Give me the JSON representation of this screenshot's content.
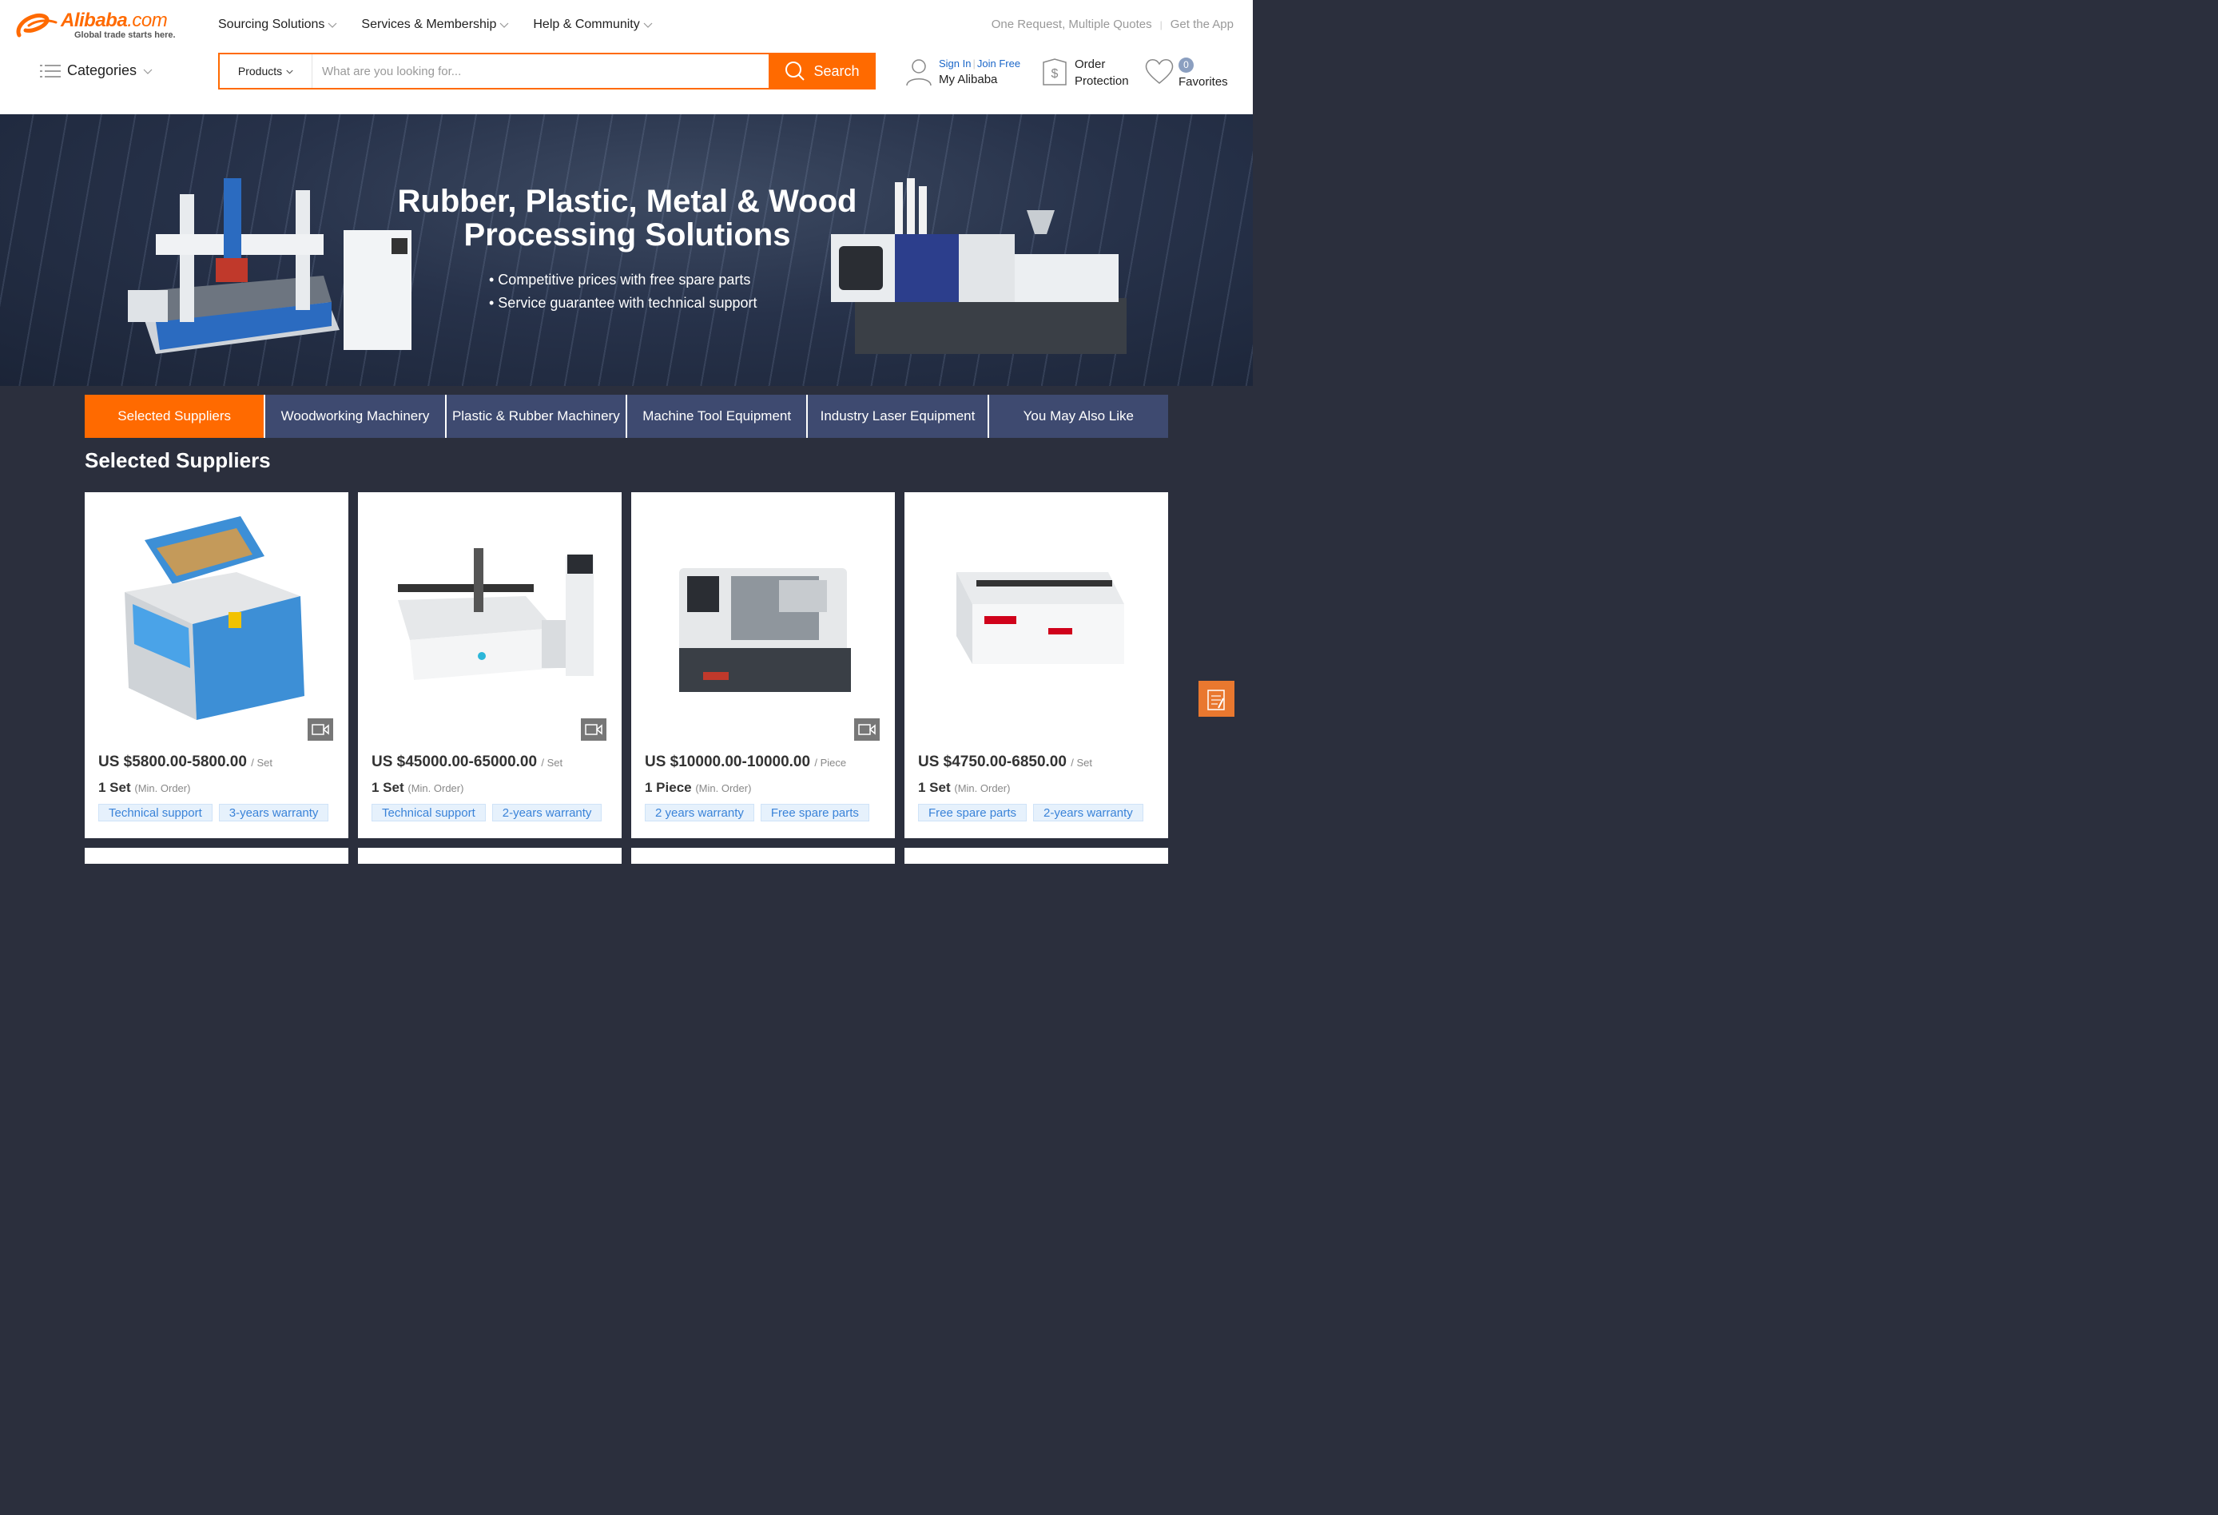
{
  "brand": {
    "name": "Alibaba",
    "domain": ".com",
    "tagline": "Global trade starts here.",
    "accent": "#ff6a00"
  },
  "topnav": [
    {
      "label": "Sourcing Solutions"
    },
    {
      "label": "Services & Membership"
    },
    {
      "label": "Help & Community"
    }
  ],
  "toplinks": {
    "quotes": "One Request, Multiple Quotes",
    "app": "Get the App"
  },
  "categories_label": "Categories",
  "search": {
    "type": "Products",
    "placeholder": "What are you looking for...",
    "button": "Search"
  },
  "account": {
    "signin": "Sign In",
    "join": "Join Free",
    "my": "My Alibaba"
  },
  "order": {
    "line1": "Order",
    "line2": "Protection"
  },
  "favorites": {
    "count": "0",
    "label": "Favorites"
  },
  "banner": {
    "title": "Rubber, Plastic, Metal & Wood Processing Solutions",
    "bullets": [
      "• Competitive prices with free spare parts",
      "• Service guarantee with technical support"
    ]
  },
  "tabs": [
    {
      "label": "Selected Suppliers",
      "active": true
    },
    {
      "label": "Woodworking Machinery"
    },
    {
      "label": "Plastic & Rubber Machinery"
    },
    {
      "label": "Machine Tool Equipment"
    },
    {
      "label": "Industry Laser Equipment"
    },
    {
      "label": "You May Also Like"
    }
  ],
  "section_title": "Selected Suppliers",
  "products": [
    {
      "price": "US $5800.00-5800.00",
      "unit": "/ Set",
      "moq": "1 Set",
      "moq_note": "(Min. Order)",
      "tags": [
        "Technical support",
        "3-years warranty"
      ],
      "video": true
    },
    {
      "price": "US $45000.00-65000.00",
      "unit": "/ Set",
      "moq": "1 Set",
      "moq_note": "(Min. Order)",
      "tags": [
        "Technical support",
        "2-years warranty"
      ],
      "video": true
    },
    {
      "price": "US $10000.00-10000.00",
      "unit": "/ Piece",
      "moq": "1 Piece",
      "moq_note": "(Min. Order)",
      "tags": [
        "2 years warranty",
        "Free spare parts"
      ],
      "video": true
    },
    {
      "price": "US $4750.00-6850.00",
      "unit": "/ Set",
      "moq": "1 Set",
      "moq_note": "(Min. Order)",
      "tags": [
        "Free spare parts",
        "2-years warranty"
      ],
      "video": false
    }
  ]
}
